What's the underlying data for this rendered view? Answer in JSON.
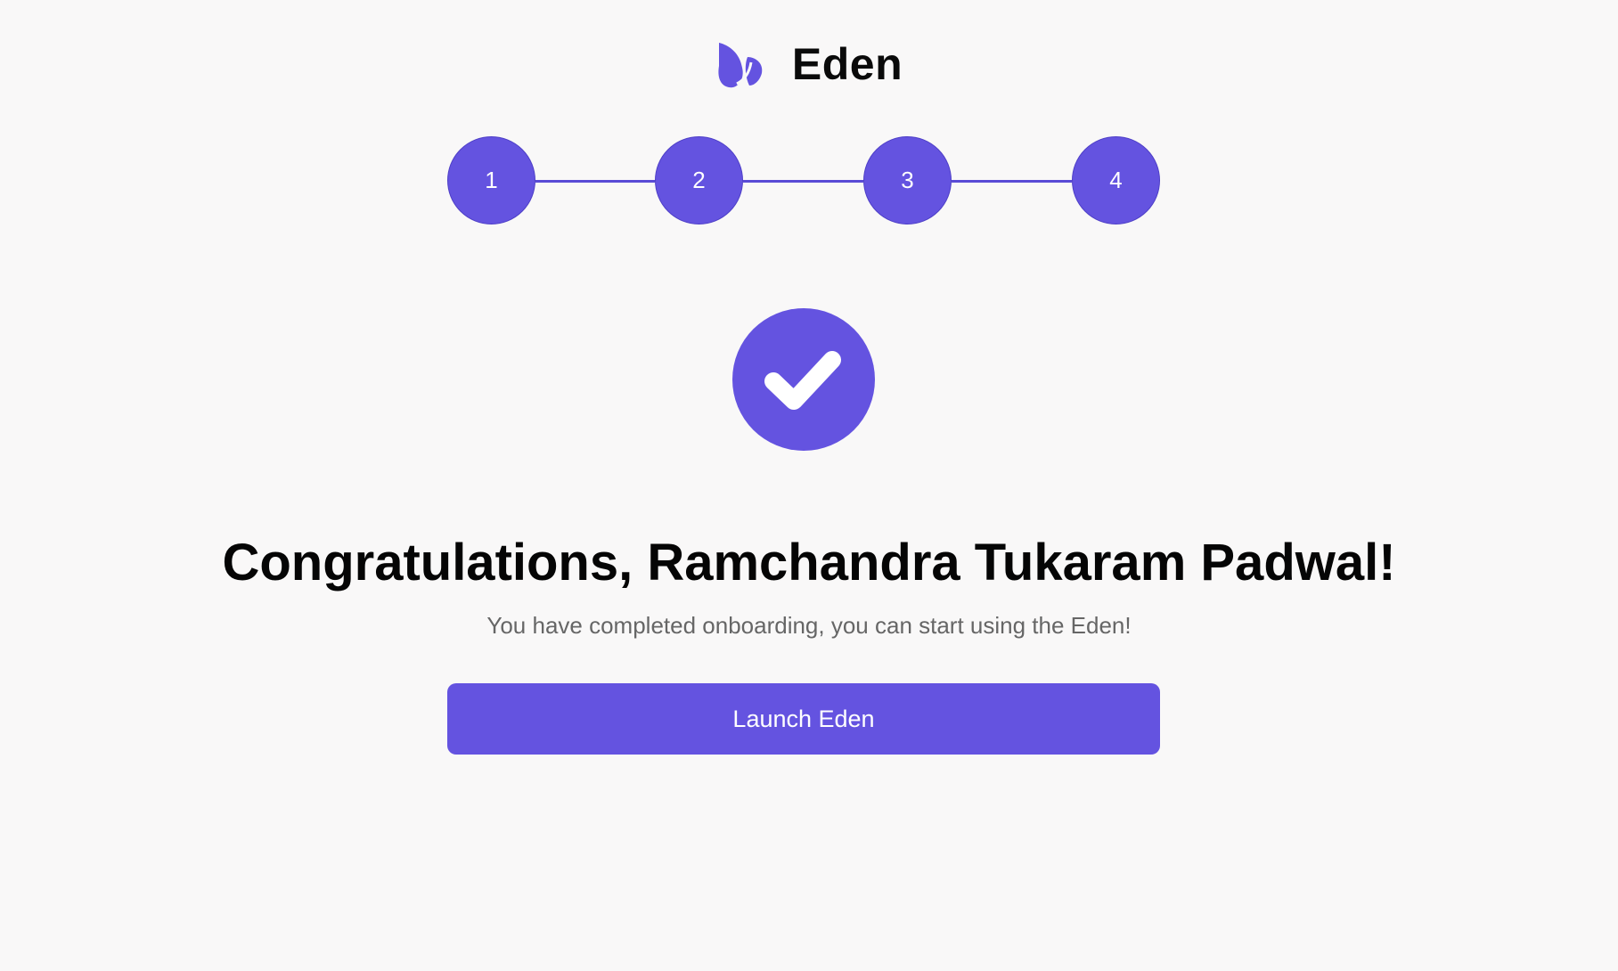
{
  "brand": {
    "name": "Eden",
    "logo_icon": "leaf-logo-icon",
    "accent_color": "#6453e0"
  },
  "stepper": {
    "steps": [
      {
        "label": "1"
      },
      {
        "label": "2"
      },
      {
        "label": "3"
      },
      {
        "label": "4"
      }
    ]
  },
  "success": {
    "icon": "checkmark-icon"
  },
  "main": {
    "title": "Congratulations, Ramchandra Tukaram Padwal!",
    "subtitle": "You have completed onboarding, you can start using the Eden!",
    "launch_label": "Launch Eden"
  }
}
